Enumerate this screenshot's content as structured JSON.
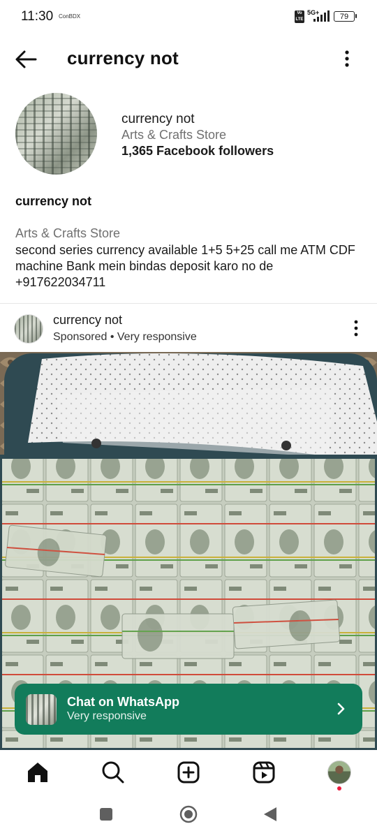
{
  "status_bar": {
    "time": "11:30",
    "carrier_badge": "ConBDX",
    "network_volte": "Vo LTE",
    "network_type": "5G+",
    "battery": "79"
  },
  "header": {
    "title": "currency not",
    "back_icon": "arrow-left-icon",
    "more_icon": "more-vertical-icon"
  },
  "profile": {
    "name": "currency not",
    "category": "Arts & Crafts Store",
    "followers": "1,365 Facebook followers"
  },
  "bio": {
    "name": "currency not",
    "category": "Arts & Crafts Store",
    "text": "second series currency available 1+5 5+25 call me ATM CDF machine Bank mein bindas deposit karo no de +917622034711"
  },
  "post": {
    "username": "currency not",
    "meta": "Sponsored • Very responsive",
    "more_icon": "more-vertical-icon"
  },
  "cta": {
    "title": "Chat on WhatsApp",
    "subtitle": "Very responsive",
    "chevron_icon": "chevron-right-icon",
    "color": "#127c5b"
  },
  "bottom_nav": {
    "items": [
      "home-icon",
      "search-icon",
      "create-icon",
      "reels-icon",
      "profile-avatar"
    ]
  },
  "system_nav": {
    "items": [
      "recents-icon",
      "home-circle-icon",
      "back-triangle-icon"
    ]
  }
}
